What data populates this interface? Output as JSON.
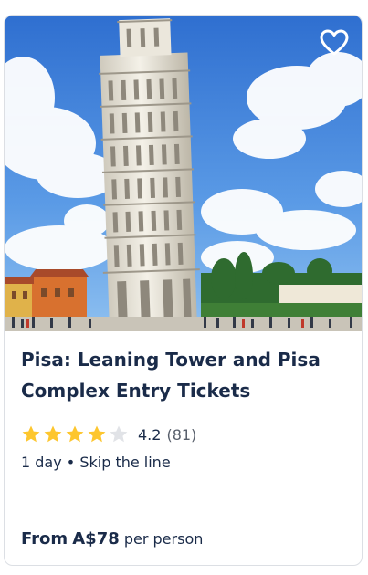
{
  "card": {
    "title": "Pisa: Leaning Tower and Pisa Complex Entry Tickets",
    "image_alt": "Leaning Tower of Pisa",
    "favorite_icon": "heart-outline-icon",
    "rating": {
      "stars": 4.2,
      "max_stars": 5,
      "value_text": "4.2",
      "count_text": "(81)",
      "star_color": "#fdc62e",
      "empty_star_color": "#e1e3e7"
    },
    "meta": {
      "duration": "1 day",
      "separator": "•",
      "feature": "Skip the line"
    },
    "price": {
      "prefix": "From",
      "amount": "A$78",
      "suffix": "per person"
    }
  },
  "colors": {
    "text_primary": "#1a2b49",
    "border": "#dcdfe4"
  }
}
